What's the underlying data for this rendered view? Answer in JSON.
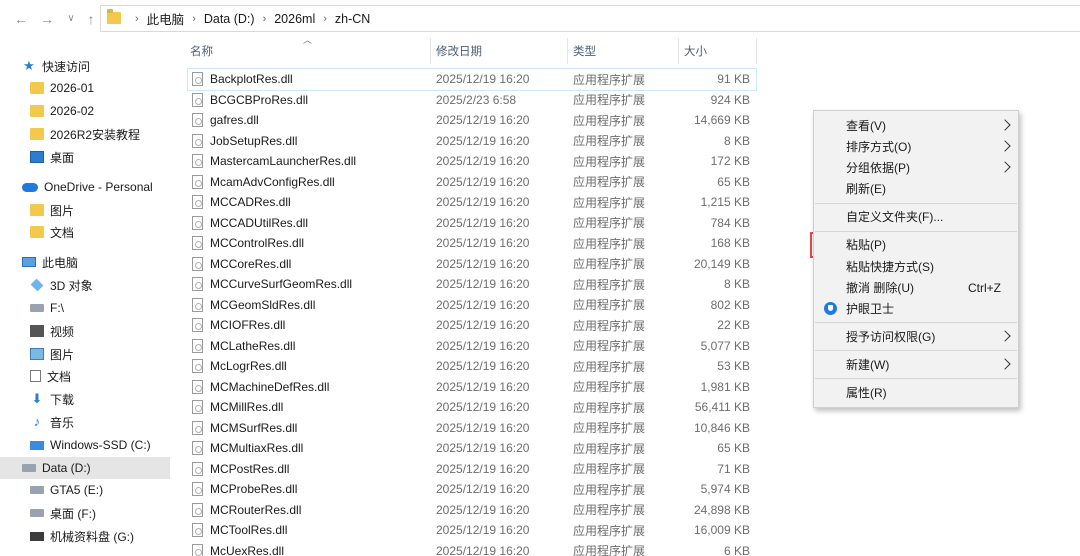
{
  "breadcrumbs": [
    "此电脑",
    "Data (D:)",
    "2026ml",
    "zh-CN"
  ],
  "columns": {
    "name": "名称",
    "date": "修改日期",
    "type": "类型",
    "size": "大小"
  },
  "sidebar": [
    {
      "label": "快速访问",
      "icon": "star-icon",
      "cls": "ico-star",
      "glyph": "★"
    },
    {
      "label": "2026-01",
      "icon": "folder-icon",
      "cls": "ico-folder",
      "glyph": ""
    },
    {
      "label": "2026-02",
      "icon": "folder-icon",
      "cls": "ico-folder",
      "glyph": ""
    },
    {
      "label": "2026R2安装教程",
      "icon": "folder-icon",
      "cls": "ico-folder",
      "glyph": ""
    },
    {
      "label": "桌面",
      "icon": "desktop-icon",
      "cls": "ico-desktop",
      "glyph": ""
    },
    {
      "label": "OneDrive - Personal",
      "icon": "cloud-icon",
      "cls": "ico-cloud",
      "glyph": ""
    },
    {
      "label": "图片",
      "icon": "folder-icon",
      "cls": "ico-folder",
      "glyph": ""
    },
    {
      "label": "文档",
      "icon": "folder-icon",
      "cls": "ico-folder",
      "glyph": ""
    },
    {
      "label": "此电脑",
      "icon": "pc-icon",
      "cls": "ico-pc",
      "glyph": ""
    },
    {
      "label": "3D 对象",
      "icon": "cube-icon",
      "cls": "ico-cube",
      "glyph": ""
    },
    {
      "label": "F:\\",
      "icon": "drive-icon",
      "cls": "ico-drive",
      "glyph": ""
    },
    {
      "label": "视频",
      "icon": "video-icon",
      "cls": "ico-video",
      "glyph": ""
    },
    {
      "label": "图片",
      "icon": "picture-icon",
      "cls": "ico-pic",
      "glyph": ""
    },
    {
      "label": "文档",
      "icon": "document-icon",
      "cls": "ico-doc",
      "glyph": ""
    },
    {
      "label": "下载",
      "icon": "download-icon",
      "cls": "ico-down",
      "glyph": "⬇"
    },
    {
      "label": "音乐",
      "icon": "music-icon",
      "cls": "ico-music",
      "glyph": "♪"
    },
    {
      "label": "Windows-SSD (C:)",
      "icon": "windows-drive-icon",
      "cls": "ico-win",
      "glyph": ""
    },
    {
      "label": "Data (D:)",
      "icon": "drive-icon",
      "cls": "ico-drive",
      "glyph": "",
      "selected": true
    },
    {
      "label": "GTA5 (E:)",
      "icon": "drive-icon",
      "cls": "ico-drive",
      "glyph": ""
    },
    {
      "label": "桌面 (F:)",
      "icon": "drive-icon",
      "cls": "ico-drive",
      "glyph": ""
    },
    {
      "label": "机械资料盘 (G:)",
      "icon": "drive-icon",
      "cls": "ico-winblack",
      "glyph": ""
    }
  ],
  "files": [
    {
      "name": "BackplotRes.dll",
      "date": "2025/12/19 16:20",
      "type": "应用程序扩展",
      "size": "91 KB"
    },
    {
      "name": "BCGCBProRes.dll",
      "date": "2025/2/23 6:58",
      "type": "应用程序扩展",
      "size": "924 KB"
    },
    {
      "name": "gafres.dll",
      "date": "2025/12/19 16:20",
      "type": "应用程序扩展",
      "size": "14,669 KB"
    },
    {
      "name": "JobSetupRes.dll",
      "date": "2025/12/19 16:20",
      "type": "应用程序扩展",
      "size": "8 KB"
    },
    {
      "name": "MastercamLauncherRes.dll",
      "date": "2025/12/19 16:20",
      "type": "应用程序扩展",
      "size": "172 KB"
    },
    {
      "name": "McamAdvConfigRes.dll",
      "date": "2025/12/19 16:20",
      "type": "应用程序扩展",
      "size": "65 KB"
    },
    {
      "name": "MCCADRes.dll",
      "date": "2025/12/19 16:20",
      "type": "应用程序扩展",
      "size": "1,215 KB"
    },
    {
      "name": "MCCADUtilRes.dll",
      "date": "2025/12/19 16:20",
      "type": "应用程序扩展",
      "size": "784 KB"
    },
    {
      "name": "MCControlRes.dll",
      "date": "2025/12/19 16:20",
      "type": "应用程序扩展",
      "size": "168 KB"
    },
    {
      "name": "MCCoreRes.dll",
      "date": "2025/12/19 16:20",
      "type": "应用程序扩展",
      "size": "20,149 KB"
    },
    {
      "name": "MCCurveSurfGeomRes.dll",
      "date": "2025/12/19 16:20",
      "type": "应用程序扩展",
      "size": "8 KB"
    },
    {
      "name": "MCGeomSldRes.dll",
      "date": "2025/12/19 16:20",
      "type": "应用程序扩展",
      "size": "802 KB"
    },
    {
      "name": "MCIOFRes.dll",
      "date": "2025/12/19 16:20",
      "type": "应用程序扩展",
      "size": "22 KB"
    },
    {
      "name": "MCLatheRes.dll",
      "date": "2025/12/19 16:20",
      "type": "应用程序扩展",
      "size": "5,077 KB"
    },
    {
      "name": "McLogrRes.dll",
      "date": "2025/12/19 16:20",
      "type": "应用程序扩展",
      "size": "53 KB"
    },
    {
      "name": "MCMachineDefRes.dll",
      "date": "2025/12/19 16:20",
      "type": "应用程序扩展",
      "size": "1,981 KB"
    },
    {
      "name": "MCMillRes.dll",
      "date": "2025/12/19 16:20",
      "type": "应用程序扩展",
      "size": "56,411 KB"
    },
    {
      "name": "MCMSurfRes.dll",
      "date": "2025/12/19 16:20",
      "type": "应用程序扩展",
      "size": "10,846 KB"
    },
    {
      "name": "MCMultiaxRes.dll",
      "date": "2025/12/19 16:20",
      "type": "应用程序扩展",
      "size": "65 KB"
    },
    {
      "name": "MCPostRes.dll",
      "date": "2025/12/19 16:20",
      "type": "应用程序扩展",
      "size": "71 KB"
    },
    {
      "name": "MCProbeRes.dll",
      "date": "2025/12/19 16:20",
      "type": "应用程序扩展",
      "size": "5,974 KB"
    },
    {
      "name": "MCRouterRes.dll",
      "date": "2025/12/19 16:20",
      "type": "应用程序扩展",
      "size": "24,898 KB"
    },
    {
      "name": "MCToolRes.dll",
      "date": "2025/12/19 16:20",
      "type": "应用程序扩展",
      "size": "16,009 KB"
    },
    {
      "name": "McUexRes.dll",
      "date": "2025/12/19 16:20",
      "type": "应用程序扩展",
      "size": "6 KB"
    }
  ],
  "context_menu": {
    "view": "查看(V)",
    "sort": "排序方式(O)",
    "group": "分组依据(P)",
    "refresh": "刷新(E)",
    "customize": "自定义文件夹(F)...",
    "paste": "粘贴(P)",
    "paste_shortcut": "粘贴快捷方式(S)",
    "undo_delete": "撤消 删除(U)",
    "undo_shortcut": "Ctrl+Z",
    "eye_guard": "护眼卫士",
    "give_access": "授予访问权限(G)",
    "new": "新建(W)",
    "properties": "属性(R)"
  },
  "colors": {
    "highlight_box": "#e24a4a",
    "accent": "#2b7cd3"
  }
}
